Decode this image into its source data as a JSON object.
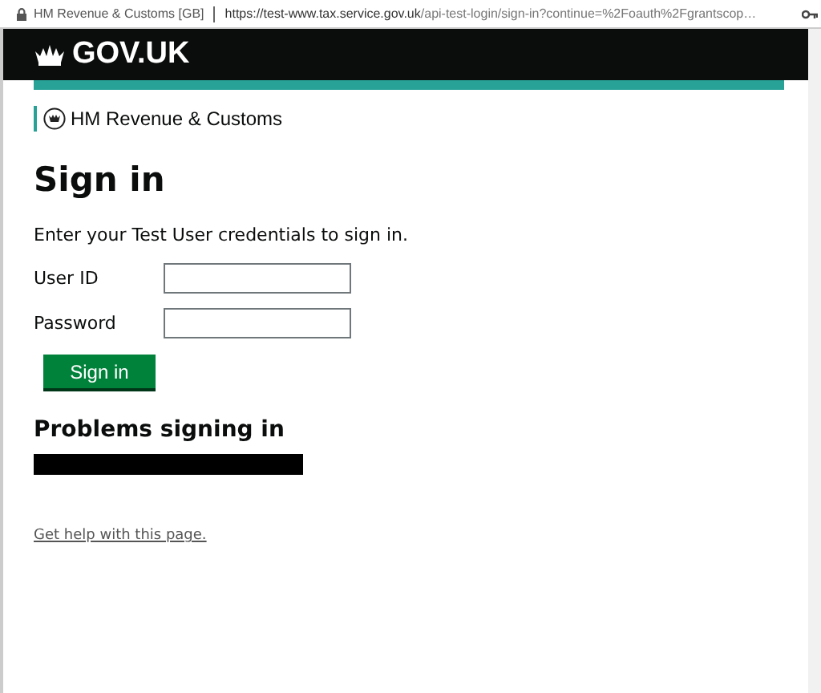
{
  "browser": {
    "page_title": "HM Revenue & Customs [GB]",
    "url_host": "https://test-www.tax.service.gov.uk",
    "url_path": "/api-test-login/sign-in?continue=%2Foauth%2Fgrantscop…"
  },
  "header": {
    "logo": "GOV.UK"
  },
  "department": "HM Revenue & Customs",
  "heading": "Sign in",
  "intro": "Enter your Test User credentials to sign in.",
  "fields": [
    {
      "label": "User ID"
    },
    {
      "label": "Password"
    }
  ],
  "submit": "Sign in",
  "problems": {
    "heading": "Problems signing in"
  },
  "help_link": "Get help with this page."
}
